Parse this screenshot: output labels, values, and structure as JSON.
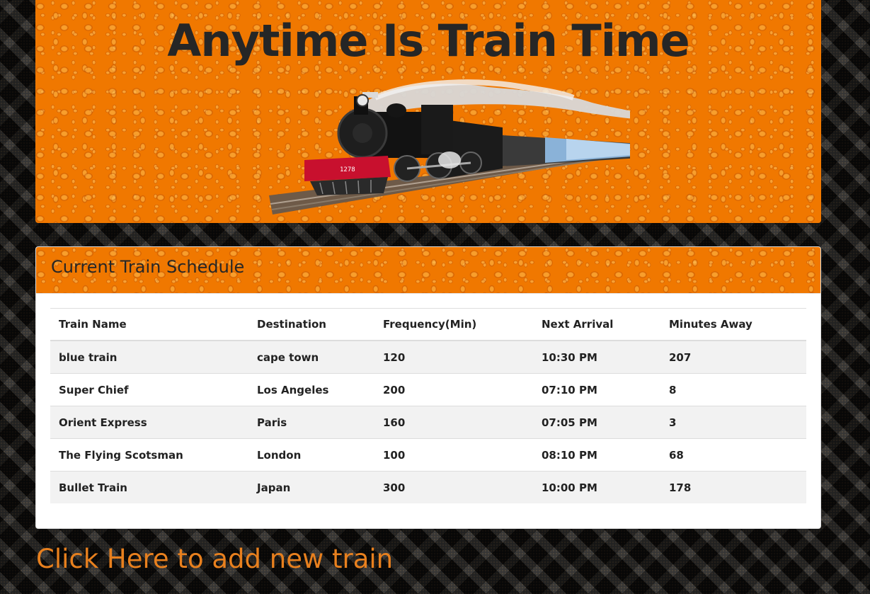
{
  "header": {
    "title": "Anytime Is Train Time",
    "locomotive_number": "1278"
  },
  "schedule": {
    "title": "Current Train Schedule",
    "columns": [
      "Train Name",
      "Destination",
      "Frequency(Min)",
      "Next Arrival",
      "Minutes Away"
    ],
    "rows": [
      [
        "blue train",
        "cape town",
        "120",
        "10:30 PM",
        "207"
      ],
      [
        "Super Chief",
        "Los Angeles",
        "200",
        "07:10 PM",
        "8"
      ],
      [
        "Orient Express",
        "Paris",
        "160",
        "07:05 PM",
        "3"
      ],
      [
        "The Flying Scotsman",
        "London",
        "100",
        "08:10 PM",
        "68"
      ],
      [
        "Bullet Train",
        "Japan",
        "300",
        "10:00 PM",
        "178"
      ]
    ]
  },
  "add_train": {
    "label": "Click Here to add new train"
  },
  "colors": {
    "accent_orange": "#f07800",
    "link_orange": "#e8801e",
    "title_dark": "#262626"
  }
}
